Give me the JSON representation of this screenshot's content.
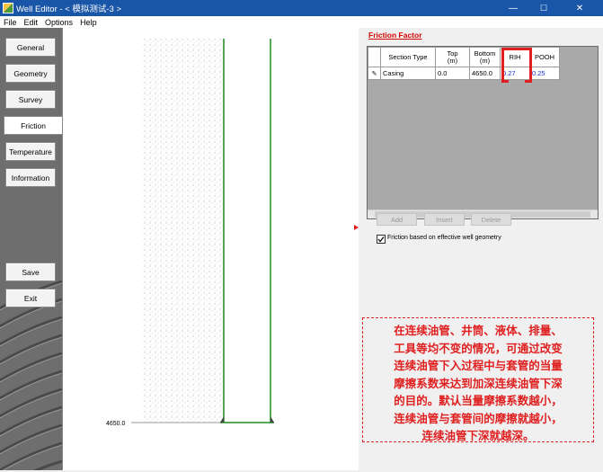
{
  "window": {
    "title": "Well Editor - < 模拟测试-3 >",
    "controls": {
      "minimize": "—",
      "maximize": "☐",
      "close": "✕"
    }
  },
  "menu": [
    "File",
    "Edit",
    "Options",
    "Help"
  ],
  "sidebar": {
    "items": [
      {
        "label": "General"
      },
      {
        "label": "Geometry"
      },
      {
        "label": "Survey"
      },
      {
        "label": "Friction",
        "active": true
      },
      {
        "label": "Temperature"
      },
      {
        "label": "Information"
      }
    ],
    "save_label": "Save",
    "exit_label": "Exit"
  },
  "plot": {
    "depth_label": "4650.0"
  },
  "friction": {
    "title": "Friction Factor",
    "columns": [
      "Section Type",
      "Top\n(m)",
      "Bottom\n(m)",
      "RIH",
      "POOH"
    ],
    "rows": [
      {
        "section_type": "Casing",
        "top": "0.0",
        "bottom": "4650.0",
        "rih": "0.27",
        "pooh": "0.25"
      }
    ],
    "buttons": {
      "add": "Add",
      "insert": "Insert",
      "delete": "Delete"
    },
    "checkbox_label": "Friction based on effective well geometry",
    "checkbox_checked": true
  },
  "note": {
    "lines": [
      "在连续油管、井筒、液体、排量、",
      "工具等均不变的情况，可通过改变",
      "连续油管下入过程中与套管的当量",
      "摩擦系数来达到加深连续油管下深",
      "的目的。默认当量摩擦系数越小，",
      "连续油管与套管间的摩擦就越小，",
      "连续油管下深就越深。"
    ]
  },
  "colors": {
    "titlebar": "#1a56a8",
    "accent_red": "#e02020",
    "well_green": "#1f8a1f",
    "value_blue": "#1a2fd4"
  }
}
